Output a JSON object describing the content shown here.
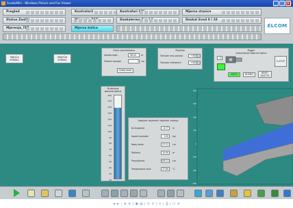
{
  "window": {
    "title": "Scada/Win - Windows Picture and Fax Viewer",
    "buttons": {
      "minimize": "_",
      "maximize": "□",
      "close": "×"
    }
  },
  "nav": {
    "row1": [
      "Pregled",
      "Kontrolor2",
      "Kontrafori 676",
      "Mjerne stanice"
    ],
    "row2": [
      "Status Zaslita",
      "Mjerenja_RST",
      "Daskalerma Svod 2",
      "Daskal Svod 0 i 10"
    ],
    "row3": [
      "Mjerenja_TET",
      "Mjerna kolica"
    ],
    "active": "Mjerna kolica",
    "logo": "ELCOM"
  },
  "left_buttons": [
    "TABLICA\nKORAKA",
    "GRAFIČKI\nKORAKA"
  ],
  "panel_zona": {
    "title": "Zona parametara",
    "fields": [
      {
        "label": "Upisite kota",
        "value": "96.00",
        "unit": "m"
      },
      {
        "label": "Trazeni razmak",
        "value": "5",
        "unit": "cm"
      }
    ],
    "button": "Unesi zona"
  },
  "panel_pozicija": {
    "title": "Pozicija",
    "selects": [
      {
        "label": "Trenutni dno panela",
        "value": "+0620"
      },
      {
        "label": "Trenutni referentni",
        "value": "+0620"
      }
    ]
  },
  "panel_pogon": {
    "title": "Pogon",
    "subtitle": "Automatski Mjerne kolice",
    "input_value": "0",
    "buttons": [
      "AUTO",
      "RUCNO",
      "RESET\nZASTITE"
    ],
    "side_button": "E-STOP"
  },
  "gauge": {
    "title": "Dubinska\nposuda kolica",
    "scale": [
      "160",
      "150",
      "140",
      "130",
      "120",
      "110",
      "100",
      "90",
      "80",
      "70",
      "60",
      "50",
      "40",
      "30",
      "20"
    ],
    "level_fraction": 0.85
  },
  "table_panel": {
    "title": "Vanjsne mjerenih mjernih valova",
    "rows": [
      {
        "label": "Ku trapezne",
        "value": "8.77",
        "unit": "m"
      },
      {
        "label": "Ispred razmaka",
        "value": "1.00",
        "unit": "kpi"
      },
      {
        "label": "Noey kolen",
        "value": "27.11",
        "unit": "cm"
      },
      {
        "label": "Rotiiona",
        "value": "10.00",
        "unit": "m"
      },
      {
        "label": "Provrijdimet",
        "value": "400.11",
        "unit": "cm"
      },
      {
        "label": "Temperatura mod",
        "value": "37.80",
        "unit": "°C"
      }
    ]
  },
  "chart_axis": {
    "labels": [
      "800",
      "600",
      "400",
      "200",
      "0",
      "-200",
      "-400",
      "-600"
    ]
  },
  "toolbar": {
    "icons": [
      "play-icon",
      "note-icon",
      "folder-icon",
      "graph-icon",
      "chart-icon",
      "list-icon",
      "zoom-icon",
      "pan-icon",
      "cut-icon",
      "copy-icon",
      "paste-icon",
      "undo-icon",
      "redo-icon",
      "print-icon",
      "grid-icon",
      "sync-icon",
      "save-icon",
      "settings-icon",
      "help-icon",
      "globe-icon",
      "world-icon",
      "exit-icon"
    ]
  },
  "pager": "◄ ► | ⊕ ⊖ | ▣ ▤ | ↻ ↺ | ✕ | ⎙ | ☐ ⊘"
}
